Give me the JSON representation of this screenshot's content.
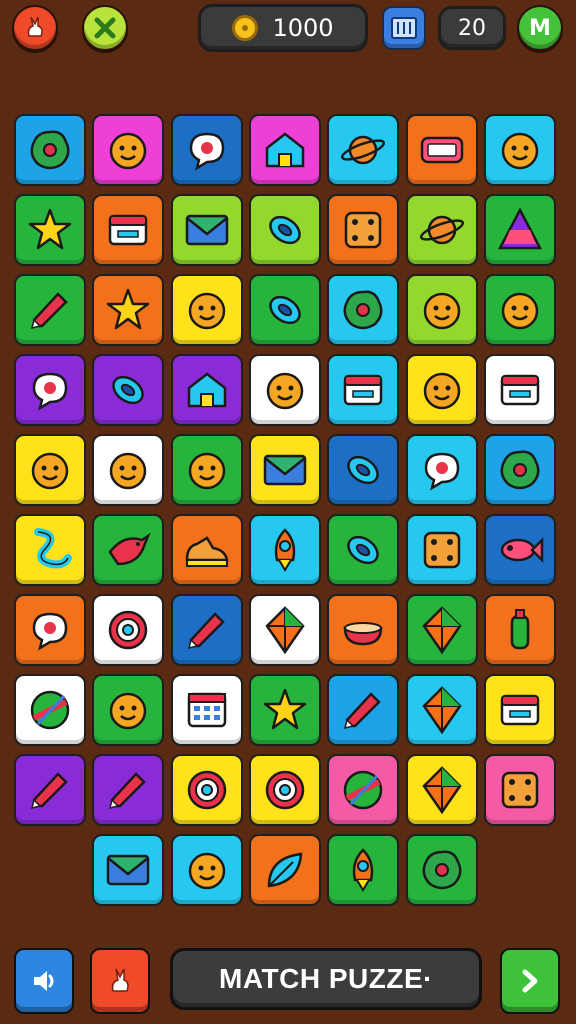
{
  "header": {
    "coins": "1000",
    "level": "20",
    "left_icon": "rabbit-icon",
    "second_icon": "shuffle-x-icon",
    "map_icon": "map-icon",
    "profile_badge": "M"
  },
  "footer": {
    "title": "MATCH PUZZE·",
    "sound_icon": "sound-icon",
    "hint_icon": "hint-icon",
    "next_icon": "arrow-right-icon"
  },
  "colors": {
    "background": "#5a2a12",
    "blue": "#1fa3e8",
    "magenta": "#ee3fd6",
    "darkblue": "#1d6fc6",
    "cyan": "#27c8f0",
    "orange": "#f2711a",
    "green": "#27b43c",
    "lime": "#92d82d",
    "yellow": "#ffe21a",
    "purple": "#8a2bd8",
    "white": "#ffffff",
    "pink": "#f45aa5"
  },
  "tiles": [
    {
      "bg": "blue",
      "icon": "blob"
    },
    {
      "bg": "magenta",
      "icon": "face"
    },
    {
      "bg": "darkblue",
      "icon": "chat"
    },
    {
      "bg": "magenta",
      "icon": "house"
    },
    {
      "bg": "cyan",
      "icon": "planet"
    },
    {
      "bg": "orange",
      "icon": "sign"
    },
    {
      "bg": "cyan",
      "icon": "face"
    },
    {
      "bg": "green",
      "icon": "star"
    },
    {
      "bg": "orange",
      "icon": "box"
    },
    {
      "bg": "lime",
      "icon": "envelope"
    },
    {
      "bg": "lime",
      "icon": "ring"
    },
    {
      "bg": "orange",
      "icon": "dice"
    },
    {
      "bg": "lime",
      "icon": "planet"
    },
    {
      "bg": "green",
      "icon": "triangle"
    },
    {
      "bg": "green",
      "icon": "pencil"
    },
    {
      "bg": "orange",
      "icon": "star"
    },
    {
      "bg": "yellow",
      "icon": "face"
    },
    {
      "bg": "green",
      "icon": "ring"
    },
    {
      "bg": "cyan",
      "icon": "blob"
    },
    {
      "bg": "lime",
      "icon": "face"
    },
    {
      "bg": "green",
      "icon": "face"
    },
    {
      "bg": "purple",
      "icon": "chat"
    },
    {
      "bg": "purple",
      "icon": "ring"
    },
    {
      "bg": "purple",
      "icon": "house"
    },
    {
      "bg": "white",
      "icon": "face"
    },
    {
      "bg": "cyan",
      "icon": "box"
    },
    {
      "bg": "yellow",
      "icon": "face"
    },
    {
      "bg": "white",
      "icon": "box"
    },
    {
      "bg": "yellow",
      "icon": "face"
    },
    {
      "bg": "white",
      "icon": "face"
    },
    {
      "bg": "green",
      "icon": "face"
    },
    {
      "bg": "yellow",
      "icon": "envelope"
    },
    {
      "bg": "darkblue",
      "icon": "ring"
    },
    {
      "bg": "cyan",
      "icon": "chat"
    },
    {
      "bg": "blue",
      "icon": "blob"
    },
    {
      "bg": "yellow",
      "icon": "snake"
    },
    {
      "bg": "green",
      "icon": "bird"
    },
    {
      "bg": "orange",
      "icon": "shoe"
    },
    {
      "bg": "cyan",
      "icon": "rocket"
    },
    {
      "bg": "green",
      "icon": "ring"
    },
    {
      "bg": "cyan",
      "icon": "dice"
    },
    {
      "bg": "darkblue",
      "icon": "fish"
    },
    {
      "bg": "orange",
      "icon": "chat"
    },
    {
      "bg": "white",
      "icon": "target"
    },
    {
      "bg": "darkblue",
      "icon": "pencil"
    },
    {
      "bg": "white",
      "icon": "kite"
    },
    {
      "bg": "orange",
      "icon": "bowl"
    },
    {
      "bg": "green",
      "icon": "kite"
    },
    {
      "bg": "orange",
      "icon": "bottle"
    },
    {
      "bg": "white",
      "icon": "ball"
    },
    {
      "bg": "green",
      "icon": "face"
    },
    {
      "bg": "white",
      "icon": "calendar"
    },
    {
      "bg": "green",
      "icon": "star"
    },
    {
      "bg": "blue",
      "icon": "pencil"
    },
    {
      "bg": "cyan",
      "icon": "kite"
    },
    {
      "bg": "yellow",
      "icon": "box"
    },
    {
      "bg": "purple",
      "icon": "pencil"
    },
    {
      "bg": "purple",
      "icon": "pencil"
    },
    {
      "bg": "yellow",
      "icon": "target"
    },
    {
      "bg": "yellow",
      "icon": "target"
    },
    {
      "bg": "pink",
      "icon": "ball"
    },
    {
      "bg": "yellow",
      "icon": "kite"
    },
    {
      "bg": "pink",
      "icon": "dice"
    },
    {
      "bg": "cyan",
      "icon": "envelope"
    },
    {
      "bg": "cyan",
      "icon": "face"
    },
    {
      "bg": "orange",
      "icon": "leaf"
    },
    {
      "bg": "green",
      "icon": "rocket"
    },
    {
      "bg": "green",
      "icon": "blob"
    }
  ]
}
